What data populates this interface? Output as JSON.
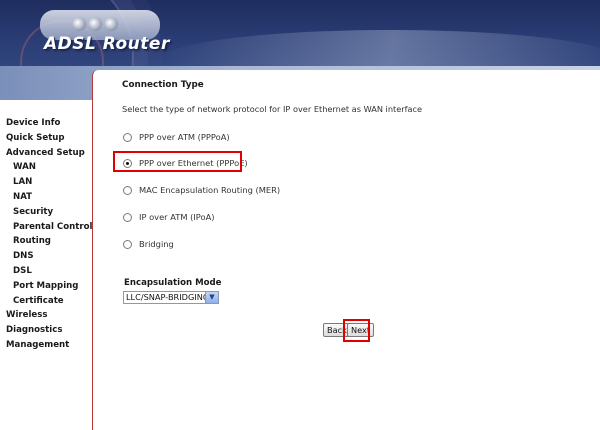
{
  "header": {
    "brand": "ADSL Router"
  },
  "sidebar": {
    "items": [
      {
        "label": "Device Info",
        "sub": false
      },
      {
        "label": "Quick Setup",
        "sub": false
      },
      {
        "label": "Advanced Setup",
        "sub": false
      },
      {
        "label": "WAN",
        "sub": true
      },
      {
        "label": "LAN",
        "sub": true
      },
      {
        "label": "NAT",
        "sub": true
      },
      {
        "label": "Security",
        "sub": true
      },
      {
        "label": "Parental Control",
        "sub": true
      },
      {
        "label": "Routing",
        "sub": true
      },
      {
        "label": "DNS",
        "sub": true
      },
      {
        "label": "DSL",
        "sub": true
      },
      {
        "label": "Port Mapping",
        "sub": true
      },
      {
        "label": "Certificate",
        "sub": true
      },
      {
        "label": "Wireless",
        "sub": false
      },
      {
        "label": "Diagnostics",
        "sub": false
      },
      {
        "label": "Management",
        "sub": false
      }
    ]
  },
  "main": {
    "title": "Connection Type",
    "description": "Select the type of network protocol for IP over Ethernet as WAN interface",
    "options": [
      {
        "label": "PPP over ATM (PPPoA)",
        "selected": false
      },
      {
        "label": "PPP over Ethernet (PPPoE)",
        "selected": true
      },
      {
        "label": "MAC Encapsulation Routing (MER)",
        "selected": false
      },
      {
        "label": "IP over ATM (IPoA)",
        "selected": false
      },
      {
        "label": "Bridging",
        "selected": false
      }
    ],
    "encapsulation_label": "Encapsulation Mode",
    "encapsulation_value": "LLC/SNAP-BRIDGING",
    "back_label": "Back",
    "next_label": "Next"
  },
  "colors": {
    "highlight": "#e00000",
    "header": "#2a3d75"
  }
}
